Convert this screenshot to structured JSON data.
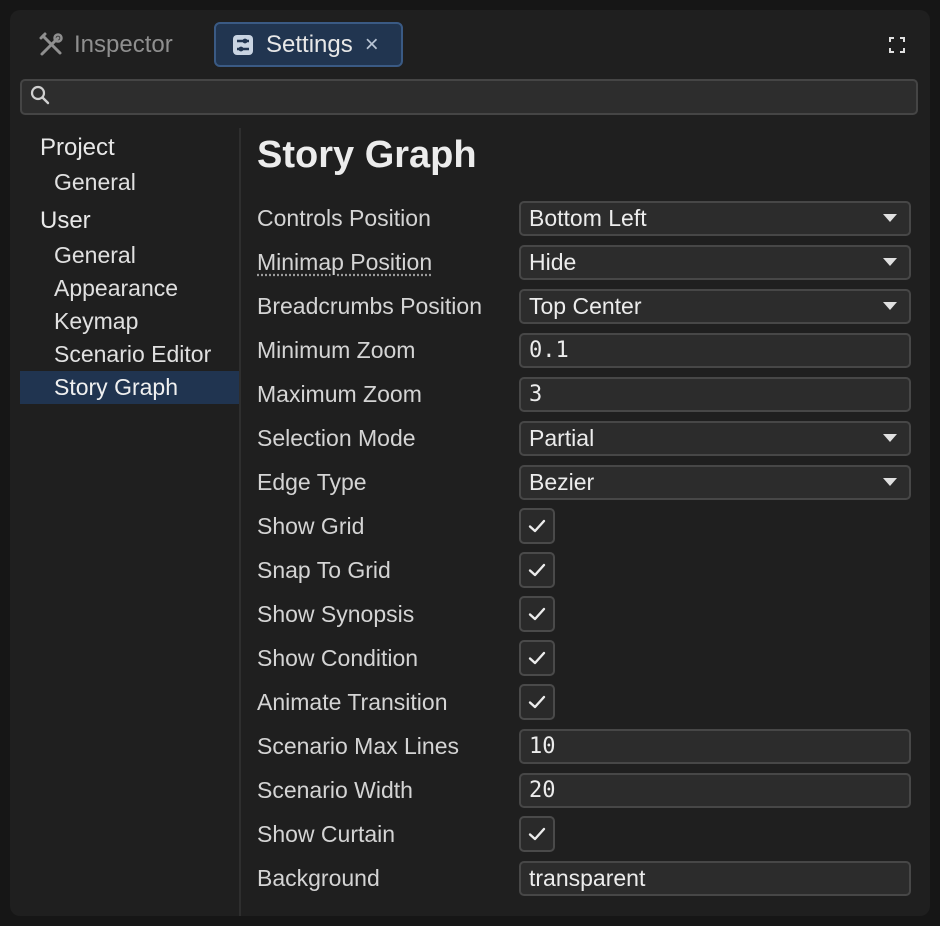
{
  "tabs": {
    "inspector": "Inspector",
    "settings": "Settings",
    "close_glyph": "×"
  },
  "search": {
    "placeholder": ""
  },
  "sidebar": {
    "groups": [
      {
        "label": "Project",
        "items": [
          "General"
        ]
      },
      {
        "label": "User",
        "items": [
          "General",
          "Appearance",
          "Keymap",
          "Scenario Editor",
          "Story Graph"
        ]
      }
    ],
    "active_item": "Story Graph"
  },
  "page": {
    "title": "Story Graph",
    "settings": [
      {
        "label": "Controls Position",
        "type": "select",
        "value": "Bottom Left"
      },
      {
        "label": "Minimap Position",
        "type": "select",
        "value": "Hide"
      },
      {
        "label": "Breadcrumbs Position",
        "type": "select",
        "value": "Top Center"
      },
      {
        "label": "Minimum Zoom",
        "type": "number",
        "value": "0.1"
      },
      {
        "label": "Maximum Zoom",
        "type": "number",
        "value": "3"
      },
      {
        "label": "Selection Mode",
        "type": "select",
        "value": "Partial"
      },
      {
        "label": "Edge Type",
        "type": "select",
        "value": "Bezier"
      },
      {
        "label": "Show Grid",
        "type": "checkbox",
        "checked": true
      },
      {
        "label": "Snap To Grid",
        "type": "checkbox",
        "checked": true
      },
      {
        "label": "Show Synopsis",
        "type": "checkbox",
        "checked": true
      },
      {
        "label": "Show Condition",
        "type": "checkbox",
        "checked": true
      },
      {
        "label": "Animate Transition",
        "type": "checkbox",
        "checked": true
      },
      {
        "label": "Scenario Max Lines",
        "type": "number",
        "value": "10"
      },
      {
        "label": "Scenario Width",
        "type": "number",
        "value": "20"
      },
      {
        "label": "Show Curtain",
        "type": "checkbox",
        "checked": true
      },
      {
        "label": "Background",
        "type": "text",
        "value": "transparent"
      }
    ]
  },
  "colors": {
    "accent": "#213550",
    "accent_border": "#3a5a84",
    "panel_bg": "#1f1f1f",
    "input_bg": "#2c2c2c"
  },
  "icons": {
    "inspector": "tools-icon",
    "settings": "sliders-icon",
    "search": "search-icon",
    "maximize": "maximize-icon",
    "dropdown": "chevron-down-icon",
    "checkbox": "check-icon"
  }
}
